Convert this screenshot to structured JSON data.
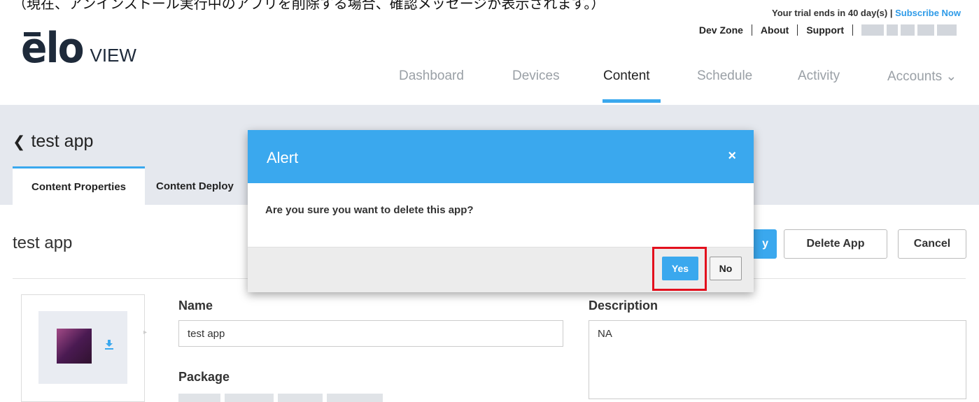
{
  "caption": "（現在、アンインストール実行中のアプリを削除する場合、確認メッセージが表示されます。）",
  "trial": {
    "text": "Your trial ends in 40 day(s) | ",
    "link": "Subscribe Now"
  },
  "toplinks": [
    "Dev Zone",
    "About",
    "Support"
  ],
  "logo": {
    "main": "elo",
    "sub": "VIEW"
  },
  "nav": {
    "items": [
      "Dashboard",
      "Devices",
      "Content",
      "Schedule",
      "Activity",
      "Accounts ⌄"
    ],
    "active": "Content"
  },
  "page": {
    "back_title": "test app",
    "tabs": [
      "Content Properties",
      "Content Deploy"
    ],
    "section_title": "test app",
    "buttons": {
      "apply_partial": "y",
      "delete": "Delete App",
      "cancel": "Cancel"
    }
  },
  "form": {
    "name_label": "Name",
    "name_value": "test app",
    "package_label": "Package",
    "description_label": "Description",
    "description_value": "NA"
  },
  "modal": {
    "title": "Alert",
    "close": "×",
    "message": "Are you sure you want to delete this app?",
    "yes": "Yes",
    "no": "No"
  },
  "colors": {
    "accent": "#3aa8ee",
    "highlight": "#e3101d",
    "header_bg": "#e5e8ee"
  }
}
